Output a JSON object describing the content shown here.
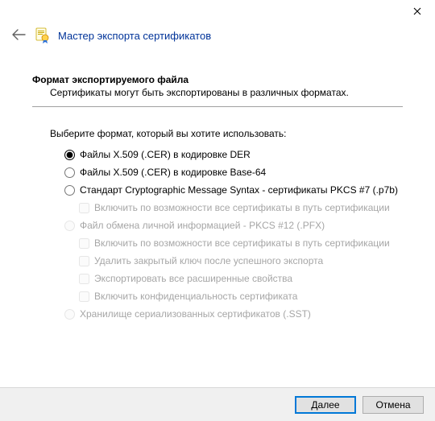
{
  "window": {
    "title": "Мастер экспорта сертификатов"
  },
  "section": {
    "heading": "Формат экспортируемого файла",
    "description": "Сертификаты могут быть экспортированы в различных форматах."
  },
  "prompt": "Выберите формат, который вы хотите использовать:",
  "options": {
    "der": "Файлы X.509 (.CER) в кодировке DER",
    "base64": "Файлы X.509 (.CER) в кодировке Base-64",
    "pkcs7": "Стандарт Cryptographic Message Syntax - сертификаты PKCS #7 (.p7b)",
    "pkcs7_include": "Включить по возможности все сертификаты в путь сертификации",
    "pfx": "Файл обмена личной информацией - PKCS #12 (.PFX)",
    "pfx_include": "Включить по возможности все сертификаты в путь сертификации",
    "pfx_delete": "Удалить закрытый ключ после успешного экспорта",
    "pfx_extended": "Экспортировать все расширенные свойства",
    "pfx_privacy": "Включить конфиденциальность сертификата",
    "sst": "Хранилище сериализованных сертификатов (.SST)"
  },
  "buttons": {
    "next": "Далее",
    "cancel": "Отмена"
  }
}
